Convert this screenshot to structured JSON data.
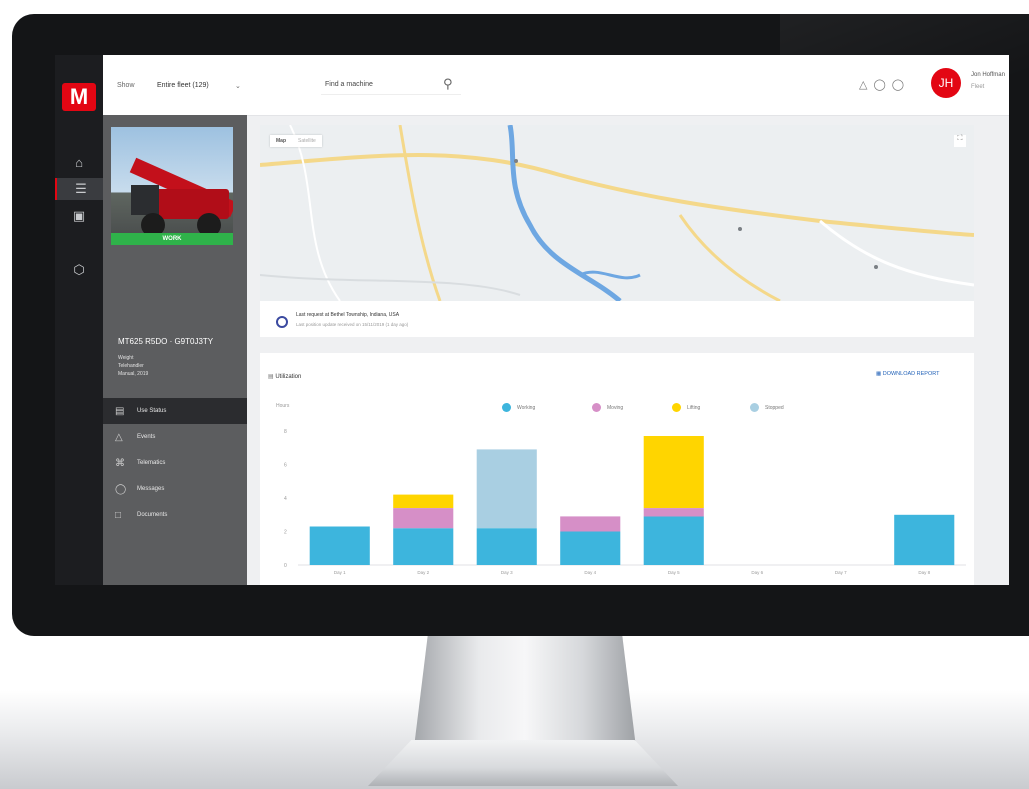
{
  "app": {
    "logo_letter": "M",
    "brand_color": "#e30613"
  },
  "rail": {
    "icons": [
      "home-icon",
      "list-icon",
      "fleet-icon",
      "box-icon"
    ]
  },
  "topbar": {
    "show_label": "Show",
    "fleet_select": "Entire fleet (129)",
    "search_placeholder": "Find a machine",
    "initials": "JH",
    "user_name": "Jon Hoffman",
    "user_role": "Fleet"
  },
  "machine": {
    "status": "WORK",
    "title": "MT625 R5DO · G9T0J3TY",
    "meta": [
      "Weight",
      "Telehandler",
      "Manual, 2019"
    ]
  },
  "nav": [
    {
      "label": "Use Status",
      "icon": "gauge-icon",
      "active": true
    },
    {
      "label": "Events",
      "icon": "warning-icon",
      "active": false
    },
    {
      "label": "Telematics",
      "icon": "signal-icon",
      "active": false
    },
    {
      "label": "Messages",
      "icon": "message-icon",
      "active": false
    },
    {
      "label": "Documents",
      "icon": "document-icon",
      "active": false
    }
  ],
  "map": {
    "toggle": [
      "Map",
      "Satellite"
    ],
    "location": "Last request at Bethel Township, Indiana, USA",
    "location_sub": "Last position update received on 15/11/2019 (1 day ago)"
  },
  "chart_card": {
    "title": "Utilization",
    "link": "DOWNLOAD REPORT",
    "ylabel": "Hours"
  },
  "chart_data": {
    "type": "bar",
    "stacked": true,
    "categories": [
      "Day 1",
      "Day 2",
      "Day 3",
      "Day 4",
      "Day 5",
      "Day 6",
      "Day 7",
      "Day 8"
    ],
    "series": [
      {
        "name": "Working",
        "color": "#3db5dd",
        "values": [
          2.3,
          2.2,
          2.2,
          2.0,
          2.9,
          0,
          0,
          3.0
        ]
      },
      {
        "name": "Moving",
        "color": "#d68fc7",
        "values": [
          0,
          1.2,
          0,
          0.9,
          0.5,
          0,
          0,
          0
        ]
      },
      {
        "name": "Lifting",
        "color": "#ffd500",
        "values": [
          0,
          0.8,
          0,
          0,
          4.3,
          0,
          0,
          0
        ]
      },
      {
        "name": "Stopped",
        "color": "#a9cfe2",
        "values": [
          0,
          0,
          4.7,
          0,
          0,
          0,
          0,
          0
        ]
      }
    ],
    "yticks": [
      "0",
      "2",
      "4",
      "6",
      "8"
    ],
    "ylim": [
      0,
      8
    ],
    "grid": false,
    "legend": "top"
  }
}
